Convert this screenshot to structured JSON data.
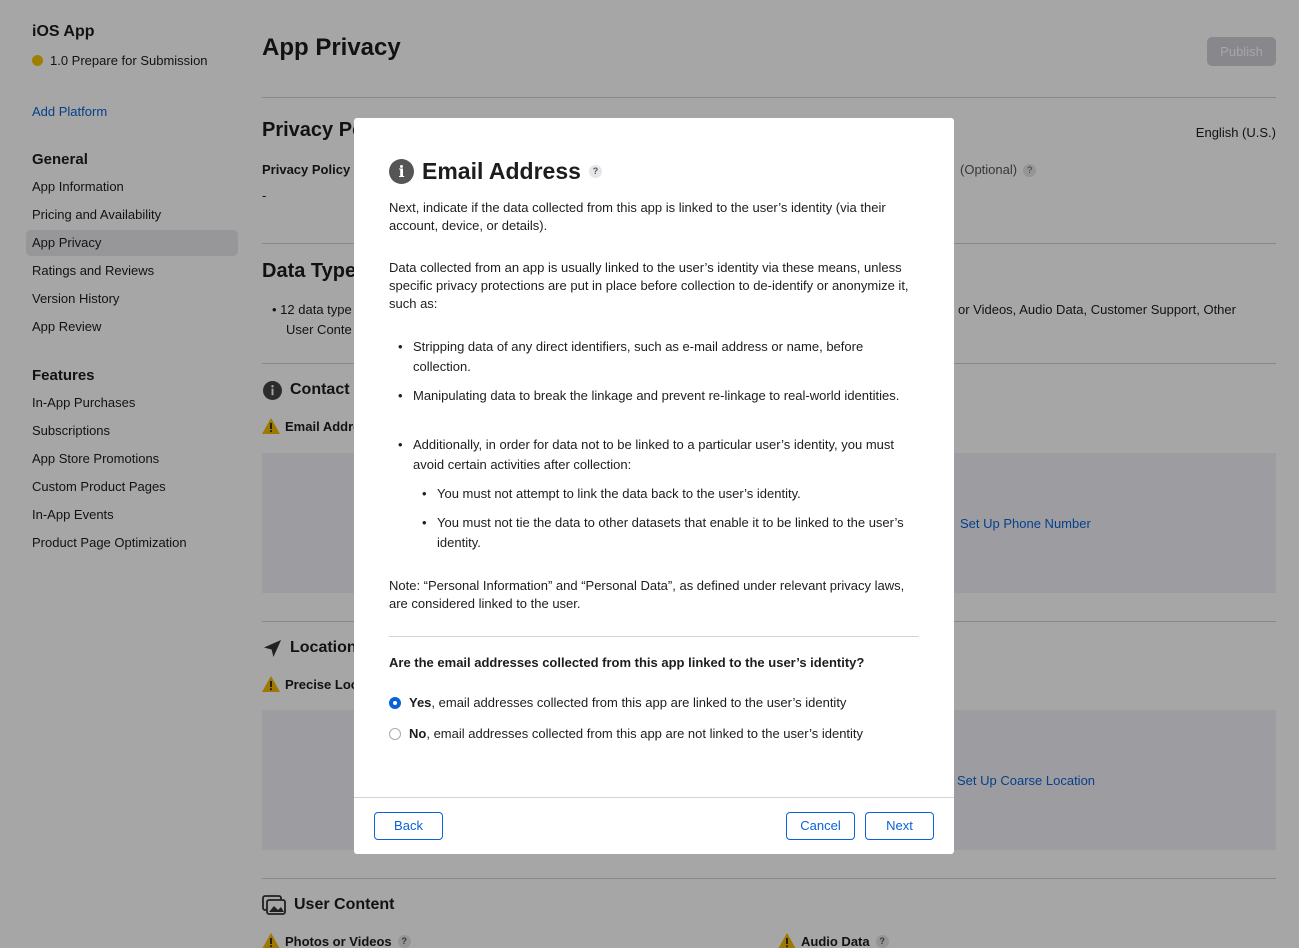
{
  "sidebar": {
    "app_name": "iOS App",
    "version_status": "1.0 Prepare for Submission",
    "add_platform": "Add Platform",
    "general_title": "General",
    "general_items": [
      "App Information",
      "Pricing and Availability",
      "App Privacy",
      "Ratings and Reviews",
      "Version History",
      "App Review"
    ],
    "features_title": "Features",
    "features_items": [
      "In-App Purchases",
      "Subscriptions",
      "App Store Promotions",
      "Custom Product Pages",
      "In-App Events",
      "Product Page Optimization"
    ]
  },
  "main": {
    "title": "App Privacy",
    "publish": "Publish",
    "privacy_policy_heading": "Privacy Po",
    "language": "English (U.S.)",
    "privacy_policy_url_label": "Privacy Policy U",
    "privacy_policy_url_value": "-",
    "optional_label": "(Optional)",
    "data_types_heading": "Data Type",
    "data_types_line1_left": "12 data type",
    "data_types_line1_right": "or Videos, Audio Data, Customer Support, Other",
    "data_types_line2": "User Conte",
    "contact_heading": "Contact I",
    "email_label": "Email Addre",
    "setup_phone": "Set Up Phone Number",
    "location_heading": "Location",
    "precise_label": "Precise Loc",
    "setup_coarse": "Set Up Coarse Location",
    "user_content_heading": "User Content",
    "photos_label": "Photos or Videos",
    "audio_label": "Audio Data"
  },
  "modal": {
    "title": "Email Address",
    "intro": "Next, indicate if the data collected from this app is linked to the user’s identity (via their account, device, or details).",
    "para2": "Data collected from an app is usually linked to the user’s identity via these means, unless specific privacy protections are put in place before collection to de-identify or anonymize it, such as:",
    "bullet1": "Stripping data of any direct identifiers, such as e-mail address or name, before collection.",
    "bullet2": "Manipulating data to break the linkage and prevent re-linkage to real-world identities.",
    "bullet3": "Additionally, in order for data not to be linked to a particular user’s identity, you must avoid certain activities after collection:",
    "sub1": "You must not attempt to link the data back to the user’s identity.",
    "sub2": "You must not tie the data to other datasets that enable it to be linked to the user’s identity.",
    "note": "Note: “Personal Information” and “Personal Data”, as defined under relevant privacy laws, are considered linked to the user.",
    "question": "Are the email addresses collected from this app linked to the user’s identity?",
    "yes_bold": "Yes",
    "yes_rest": ", email addresses collected from this app are linked to the user’s identity",
    "no_bold": "No",
    "no_rest": ", email addresses collected from this app are not linked to the user’s identity",
    "selected_option": "Yes",
    "back": "Back",
    "cancel": "Cancel",
    "next": "Next"
  },
  "colors": {
    "accent": "#0a63d6",
    "status_dot": "#f5c400",
    "warning": "#f5b800"
  }
}
